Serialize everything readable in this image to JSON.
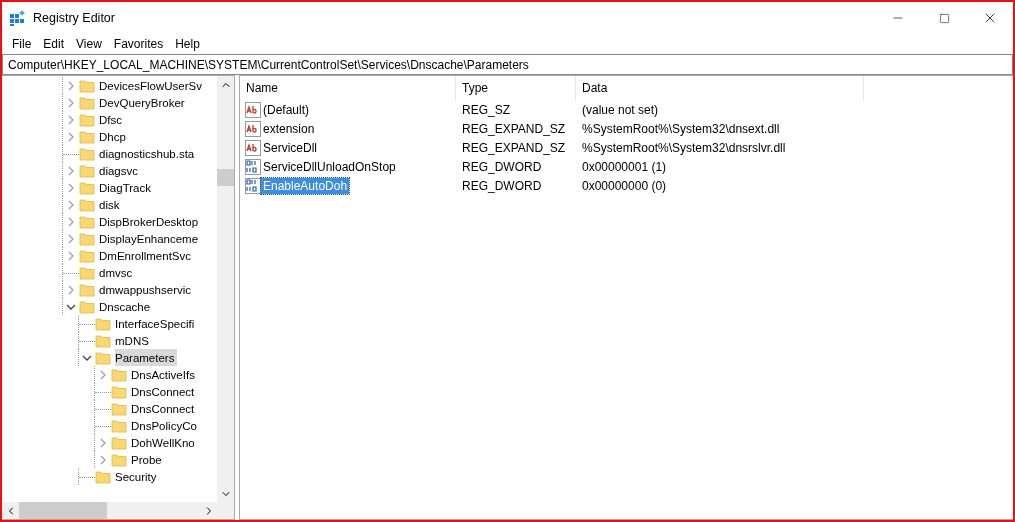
{
  "window": {
    "title": "Registry Editor"
  },
  "menu": [
    "File",
    "Edit",
    "View",
    "Favorites",
    "Help"
  ],
  "address": "Computer\\HKEY_LOCAL_MACHINE\\SYSTEM\\CurrentControlSet\\Services\\Dnscache\\Parameters",
  "tree": [
    {
      "label": "DevicesFlowUserSv",
      "expanded": false,
      "selected": false
    },
    {
      "label": "DevQueryBroker",
      "expanded": false,
      "selected": false
    },
    {
      "label": "Dfsc",
      "expanded": false,
      "selected": false
    },
    {
      "label": "Dhcp",
      "expanded": false,
      "selected": false
    },
    {
      "label": "diagnosticshub.sta",
      "selected": false
    },
    {
      "label": "diagsvc",
      "expanded": false,
      "selected": false
    },
    {
      "label": "DiagTrack",
      "expanded": false,
      "selected": false
    },
    {
      "label": "disk",
      "expanded": false,
      "selected": false
    },
    {
      "label": "DispBrokerDesktop",
      "expanded": false,
      "selected": false
    },
    {
      "label": "DisplayEnhanceme",
      "expanded": false,
      "selected": false
    },
    {
      "label": "DmEnrollmentSvc",
      "expanded": false,
      "selected": false
    },
    {
      "label": "dmvsc",
      "selected": false
    },
    {
      "label": "dmwappushservic",
      "expanded": false,
      "selected": false
    },
    {
      "label": "Dnscache",
      "expanded": true,
      "selected": false,
      "children": [
        {
          "label": "InterfaceSpecifi",
          "selected": false
        },
        {
          "label": "mDNS",
          "selected": false
        },
        {
          "label": "Parameters",
          "expanded": true,
          "selected": true,
          "children": [
            {
              "label": "DnsActiveIfs",
              "expanded": false,
              "selected": false
            },
            {
              "label": "DnsConnect",
              "selected": false
            },
            {
              "label": "DnsConnect",
              "selected": false
            },
            {
              "label": "DnsPolicyCo",
              "selected": false
            },
            {
              "label": "DohWellKno",
              "expanded": false,
              "selected": false
            },
            {
              "label": "Probe",
              "expanded": false,
              "selected": false
            }
          ]
        },
        {
          "label": "Security",
          "selected": false
        }
      ]
    }
  ],
  "table": {
    "columns": [
      "Name",
      "Type",
      "Data"
    ],
    "rows": [
      {
        "kind": "string",
        "name": "(Default)",
        "type": "REG_SZ",
        "data": "(value not set)",
        "selected": false
      },
      {
        "kind": "string",
        "name": "extension",
        "type": "REG_EXPAND_SZ",
        "data": "%SystemRoot%\\System32\\dnsext.dll",
        "selected": false
      },
      {
        "kind": "string",
        "name": "ServiceDll",
        "type": "REG_EXPAND_SZ",
        "data": "%SystemRoot%\\System32\\dnsrslvr.dll",
        "selected": false
      },
      {
        "kind": "binary",
        "name": "ServiceDllUnloadOnStop",
        "type": "REG_DWORD",
        "data": "0x00000001 (1)",
        "selected": false
      },
      {
        "kind": "binary",
        "name": "EnableAutoDoh",
        "type": "REG_DWORD",
        "data": "0x00000000 (0)",
        "selected": true
      }
    ]
  }
}
